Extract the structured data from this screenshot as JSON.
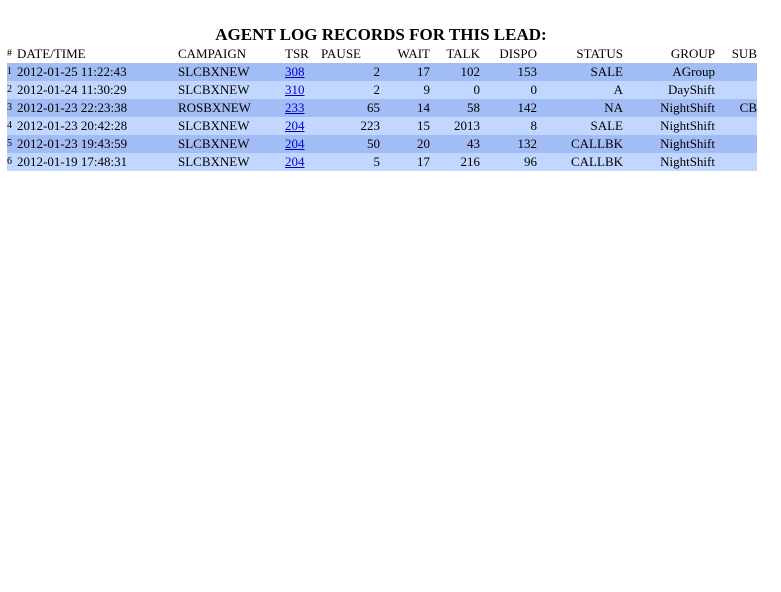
{
  "title": "AGENT LOG RECORDS FOR THIS LEAD:",
  "headers": {
    "num": "#",
    "datetime": "DATE/TIME",
    "campaign": "CAMPAIGN",
    "tsr": "TSR",
    "pause": "PAUSE",
    "wait": "WAIT",
    "talk": "TALK",
    "dispo": "DISPO",
    "status": "STATUS",
    "group": "GROUP",
    "sub": "SUB"
  },
  "rows": [
    {
      "num": "1",
      "datetime": "2012-01-25 11:22:43",
      "campaign": "SLCBXNEW",
      "tsr": "308",
      "pause": "2",
      "wait": "17",
      "talk": "102",
      "dispo": "153",
      "status": "SALE",
      "group": "AGroup",
      "sub": ""
    },
    {
      "num": "2",
      "datetime": "2012-01-24 11:30:29",
      "campaign": "SLCBXNEW",
      "tsr": "310",
      "pause": "2",
      "wait": "9",
      "talk": "0",
      "dispo": "0",
      "status": "A",
      "group": "DayShift",
      "sub": ""
    },
    {
      "num": "3",
      "datetime": "2012-01-23 22:23:38",
      "campaign": "ROSBXNEW",
      "tsr": "233",
      "pause": "65",
      "wait": "14",
      "talk": "58",
      "dispo": "142",
      "status": "NA",
      "group": "NightShift",
      "sub": "CB"
    },
    {
      "num": "4",
      "datetime": "2012-01-23 20:42:28",
      "campaign": "SLCBXNEW",
      "tsr": "204",
      "pause": "223",
      "wait": "15",
      "talk": "2013",
      "dispo": "8",
      "status": "SALE",
      "group": "NightShift",
      "sub": ""
    },
    {
      "num": "5",
      "datetime": "2012-01-23 19:43:59",
      "campaign": "SLCBXNEW",
      "tsr": "204",
      "pause": "50",
      "wait": "20",
      "talk": "43",
      "dispo": "132",
      "status": "CALLBK",
      "group": "NightShift",
      "sub": ""
    },
    {
      "num": "6",
      "datetime": "2012-01-19 17:48:31",
      "campaign": "SLCBXNEW",
      "tsr": "204",
      "pause": "5",
      "wait": "17",
      "talk": "216",
      "dispo": "96",
      "status": "CALLBK",
      "group": "NightShift",
      "sub": ""
    }
  ],
  "colors": {
    "row_dark": "#a2bdf5",
    "row_light": "#c2d7ff",
    "link": "#0000cc"
  }
}
